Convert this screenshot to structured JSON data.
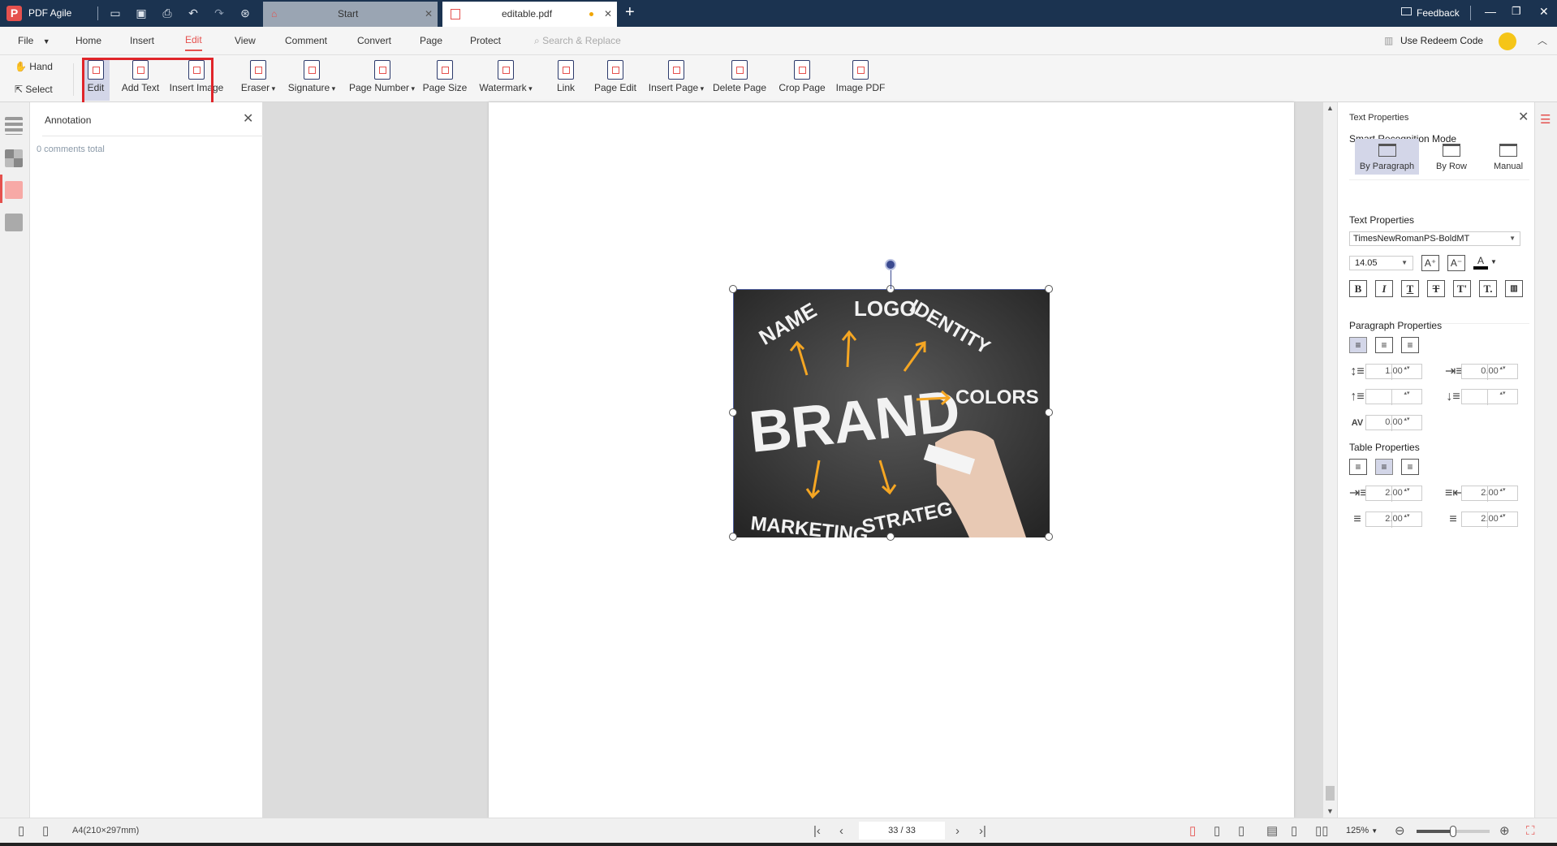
{
  "app": {
    "name": "PDF Agile",
    "feedback": "Feedback",
    "accent": "#e5514e",
    "titlebar_color": "#1b3350"
  },
  "quick_icons": [
    "open-folder-icon",
    "save-icon",
    "print-icon",
    "undo-icon",
    "redo-icon",
    "upload-icon"
  ],
  "tabs": [
    {
      "label": "Start",
      "active": false
    },
    {
      "label": "editable.pdf",
      "active": true,
      "modified": true
    }
  ],
  "menu": {
    "file": "File",
    "items": [
      "Home",
      "Insert",
      "Edit",
      "View",
      "Comment",
      "Convert",
      "Page",
      "Protect"
    ],
    "active": "Edit",
    "search_placeholder": "Search & Replace",
    "redeem": "Use Redeem Code"
  },
  "toolbar": {
    "hand": "Hand",
    "select": "Select",
    "tools": [
      "Edit",
      "Add Text",
      "Insert Image",
      "Eraser",
      "Signature",
      "Page Number",
      "Page Size",
      "Watermark",
      "Link",
      "Page Edit",
      "Insert Page",
      "Delete Page",
      "Crop Page",
      "Image PDF"
    ],
    "dropdown_tools": [
      "Eraser",
      "Signature",
      "Page Number",
      "Watermark",
      "Insert Page"
    ],
    "active": "Edit"
  },
  "annotation": {
    "title": "Annotation",
    "count_text": "0 comments total"
  },
  "image": {
    "words": [
      "NAME",
      "LOGO",
      "IDENTITY",
      "BRAND",
      "COLORS",
      "MARKETING",
      "STRATEGY"
    ]
  },
  "text_properties": {
    "title": "Text Properties",
    "smart_mode_label": "Smart Recognition Mode",
    "modes": [
      "By Paragraph",
      "By Row",
      "Manual"
    ],
    "selected_mode": "By Paragraph",
    "section_text": "Text Properties",
    "font": "TimesNewRomanPS-BoldMT",
    "size": "14.05",
    "section_paragraph": "Paragraph Properties",
    "line_spacing": "1.00",
    "indent": "0.00",
    "space_before": "",
    "space_after": "",
    "char_spacing": "0.00",
    "section_table": "Table Properties",
    "table_left": "2.00",
    "table_right": "2.00",
    "table_top": "2.00",
    "table_bottom": "2.00"
  },
  "status": {
    "page_size": "A4(210×297mm)",
    "page": "33 / 33",
    "zoom": "125%",
    "zoom_fraction": 0.5
  }
}
